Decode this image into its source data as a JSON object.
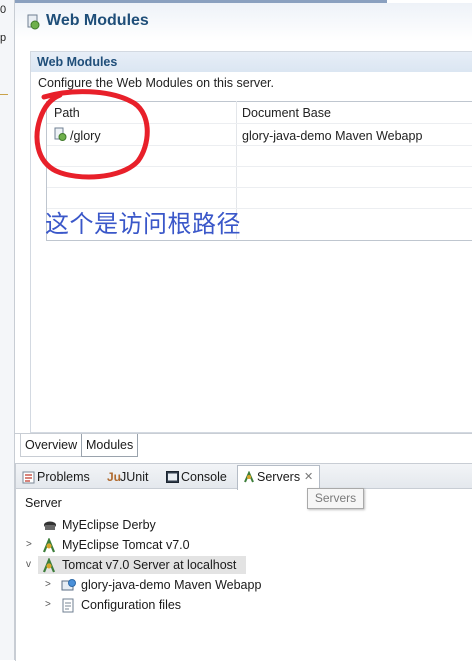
{
  "left_strip": {
    "text_top": "0",
    "text_mid": "p"
  },
  "editor": {
    "title": "Web Modules",
    "section": {
      "title": "Web Modules",
      "description": "Configure the Web Modules on this server.",
      "table": {
        "columns": [
          "Path",
          "Document Base"
        ],
        "rows": [
          {
            "path": "/glory",
            "document_base": "glory-java-demo Maven Webapp"
          }
        ]
      }
    },
    "annotation": "这个是访问根路径",
    "tabs": [
      "Overview",
      "Modules"
    ],
    "active_tab": "Modules"
  },
  "views": {
    "tabs": [
      {
        "label": "Problems",
        "icon": "problems-icon"
      },
      {
        "label": "JUnit",
        "icon": "junit-icon"
      },
      {
        "label": "Console",
        "icon": "console-icon"
      },
      {
        "label": "Servers",
        "icon": "servers-icon"
      }
    ],
    "active_tab": "Servers",
    "tooltip": "Servers",
    "tree_header": "Server",
    "tree": [
      {
        "label": "MyEclipse Derby",
        "icon": "derby-icon",
        "expander": ""
      },
      {
        "label": "MyEclipse Tomcat v7.0",
        "icon": "tomcat-icon",
        "expander": "collapsed"
      },
      {
        "label": "Tomcat v7.0 Server at localhost",
        "icon": "tomcat-icon",
        "expander": "expanded",
        "selected": true
      },
      {
        "label": "glory-java-demo Maven Webapp",
        "icon": "webapp-icon",
        "expander": "collapsed"
      },
      {
        "label": "Configuration files",
        "icon": "config-files-icon",
        "expander": "collapsed"
      }
    ]
  },
  "colors": {
    "title_blue": "#1f4e79",
    "annotation_blue": "#3a57c9",
    "circle_red": "#e8202a"
  }
}
